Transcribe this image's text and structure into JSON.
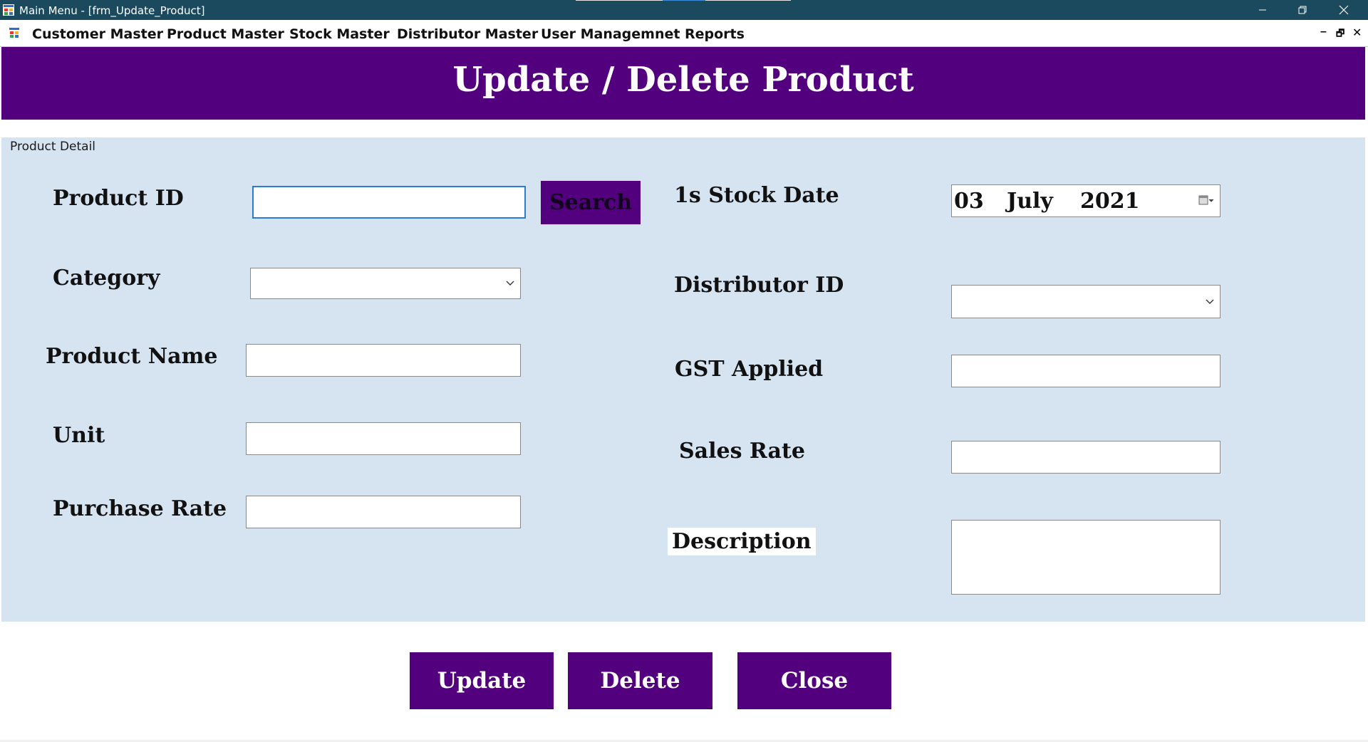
{
  "window": {
    "title": "Main Menu - [frm_Update_Product]"
  },
  "menu": {
    "items": [
      "Customer Master",
      "Product Master",
      "Stock Master",
      "Distributor Master",
      "User Managemnet",
      "Reports"
    ],
    "mdi_controls": [
      "–",
      "🗗",
      "✕"
    ]
  },
  "form": {
    "heading": "Update / Delete Product",
    "group_title": "Product Detail",
    "fields": {
      "product_id": {
        "label": "Product ID",
        "value": ""
      },
      "category": {
        "label": "Category",
        "value": ""
      },
      "product_name": {
        "label": "Product Name",
        "value": ""
      },
      "unit": {
        "label": "Unit",
        "value": ""
      },
      "purchase_rate": {
        "label": "Purchase Rate",
        "value": ""
      },
      "stock_date": {
        "label": "1s Stock Date",
        "day": "03",
        "month": "July",
        "year": "2021"
      },
      "distributor_id": {
        "label": "Distributor ID",
        "value": ""
      },
      "gst_applied": {
        "label": "GST Applied",
        "value": ""
      },
      "sales_rate": {
        "label": "Sales Rate",
        "value": ""
      },
      "description": {
        "label": "Description",
        "value": ""
      }
    },
    "search_button": "Search",
    "buttons": {
      "update": "Update",
      "delete": "Delete",
      "close": "Close"
    }
  },
  "colors": {
    "titlebar": "#1b4a5f",
    "accent_purple": "#52007d",
    "group_background": "#d6e3f0"
  },
  "icons": {
    "app": "app-form-icon",
    "menu": "mdi-child-icon",
    "date": "calendar-dropdown-icon",
    "dropdown": "chevron-down-icon"
  }
}
